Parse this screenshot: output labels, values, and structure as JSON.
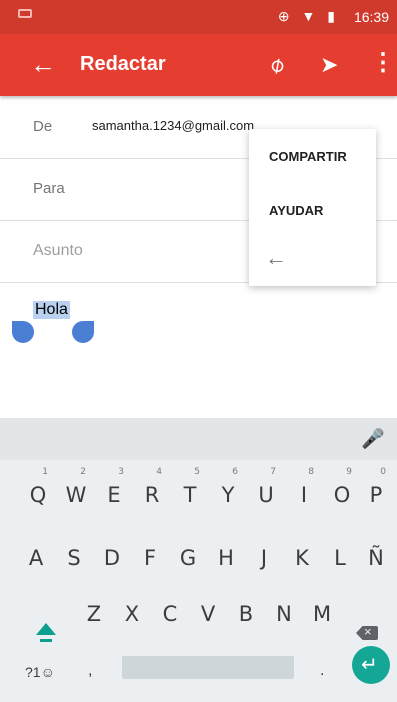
{
  "status_bar": {
    "time": "16:39",
    "icons": "⊕ ▼ ▮"
  },
  "app_bar": {
    "title": "Redactar",
    "back_icon": "←",
    "attach_icon": "⌀",
    "send_icon": "➤",
    "more_icon": "⋮"
  },
  "compose": {
    "from_label": "De",
    "from_value": "samantha.1234@gmail.com",
    "to_label": "Para",
    "to_chevron": "⌄",
    "subject_label": "Asunto",
    "body_text": "Hola"
  },
  "menu": {
    "share": "COMPARTIR",
    "help": "AYUDAR",
    "back": "←"
  },
  "keyboard": {
    "mic_icon": "🎤",
    "row1": [
      "Q",
      "W",
      "E",
      "R",
      "T",
      "Y",
      "U",
      "I",
      "O",
      "P"
    ],
    "row1_sup": [
      "1",
      "2",
      "3",
      "4",
      "5",
      "6",
      "7",
      "8",
      "9",
      "0"
    ],
    "row2": [
      "A",
      "S",
      "D",
      "F",
      "G",
      "H",
      "J",
      "K",
      "L",
      "Ñ"
    ],
    "row3": [
      "Z",
      "X",
      "C",
      "V",
      "B",
      "N",
      "M"
    ],
    "symbols": "?1☺",
    "comma": ",",
    "period": ".",
    "enter_icon": "↵",
    "backspace_icon": "×"
  }
}
